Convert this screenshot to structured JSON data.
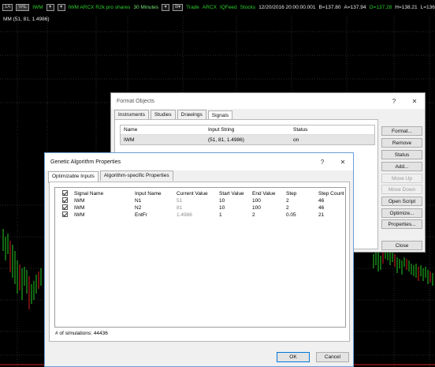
{
  "toolbar": {
    "buttons": [
      "1A",
      "VAL"
    ],
    "symbol": "IWM",
    "symbol_btn_a": "▾",
    "symbol_btn_b": "▾",
    "description": "IWM ARCX R2k pro shares",
    "interval": "30 Minutes",
    "interval_btn": "▾",
    "price_btn": "B▾",
    "trade_label": "Trade",
    "exchange": "ARCX",
    "feed": "IQFeed",
    "category": "Stocks",
    "datetime": "12/20/2016 20:00:00.001",
    "bid": "B=137.80",
    "ask": "A=137.94",
    "open": "O=137.28",
    "high": "H=138.21",
    "low": "L=136"
  },
  "study_label": "MM (51, 81, 1.4986)",
  "format_objects": {
    "title": "Format Objects",
    "help": "?",
    "close": "✕",
    "tabs": [
      "Instruments",
      "Studies",
      "Drawings",
      "Signals"
    ],
    "active_tab": 3,
    "columns": [
      "Name",
      "Input String",
      "Status"
    ],
    "rows": [
      {
        "name": "IWM",
        "input": "(51,  81,  1.4986)",
        "status": "on"
      }
    ],
    "buttons": [
      "Format...",
      "Remove",
      "Status",
      "Add...",
      "Move Up",
      "Move Down",
      "Open Script",
      "Optimize...",
      "Properties..."
    ],
    "close_button": "Close"
  },
  "ga": {
    "title": "Genetic Algorithm Properties",
    "help": "?",
    "close": "✕",
    "tabs": [
      "Optimizable Inputs",
      "Algorithm-specific Properties"
    ],
    "columns": [
      "Signal Name",
      "Input Name",
      "Current Value",
      "Start Value",
      "End Value",
      "Step",
      "Step Count"
    ],
    "rows": [
      {
        "signal": "IWM",
        "input": "N1",
        "current": "51",
        "start": "10",
        "end": "100",
        "step": "2",
        "count": "46"
      },
      {
        "signal": "IWM",
        "input": "N2",
        "current": "81",
        "start": "10",
        "end": "100",
        "step": "2",
        "count": "46"
      },
      {
        "signal": "IWM",
        "input": "EntFr",
        "current": "1.4986",
        "start": "1",
        "end": "2",
        "step": "0.05",
        "count": "21"
      }
    ],
    "simulations": "# of simulations: 44436",
    "ok": "OK",
    "cancel": "Cancel"
  },
  "colors": {
    "background": "#000000",
    "candle_up": "#22c922",
    "candle_down": "#d82020",
    "window_bg": "#f0f0f0",
    "selection": "#e5e5e5"
  }
}
